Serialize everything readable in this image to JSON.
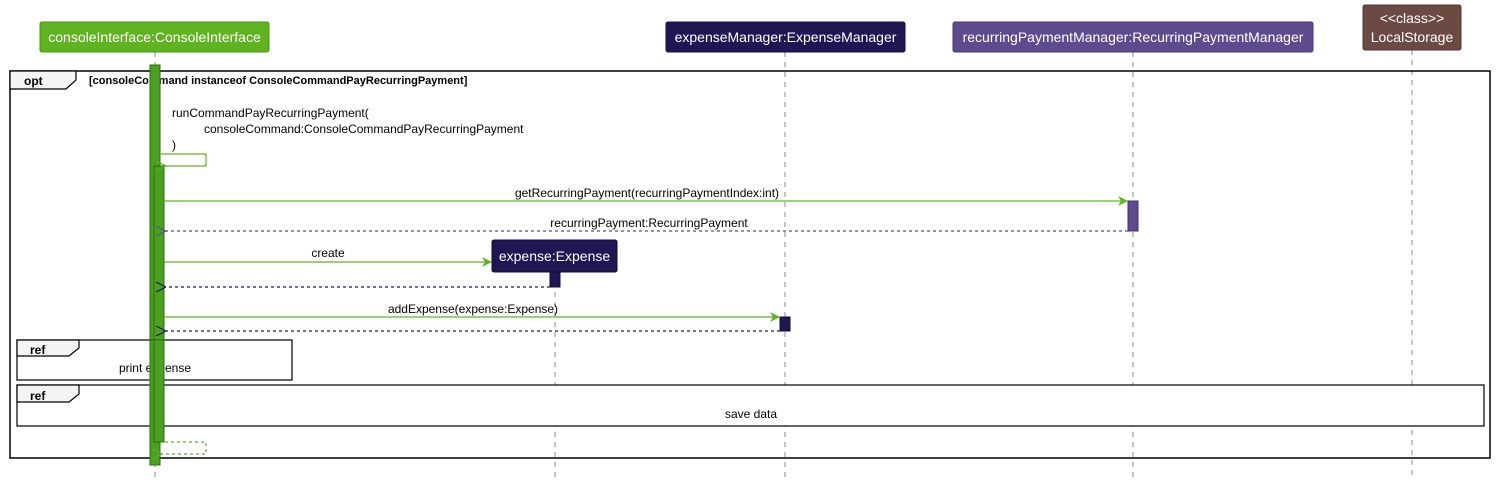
{
  "colors": {
    "console": "#5fb320",
    "console_activation": "#4aa121",
    "expense_manager": "#1f1754",
    "recurring_manager": "#5e4a8c",
    "local_storage": "#6b4a44",
    "expense": "#1f1754",
    "message_line": "#5fb320"
  },
  "participants": {
    "console": "consoleInterface:ConsoleInterface",
    "expense_manager": "expenseManager:ExpenseManager",
    "recurring_manager": "recurringPaymentManager:RecurringPaymentManager",
    "local_storage_stereotype": "<<class>>",
    "local_storage": "LocalStorage",
    "expense": "expense:Expense"
  },
  "opt_frame": {
    "keyword": "opt",
    "guard": "[consoleCommand instanceof ConsoleCommandPayRecurringPayment]"
  },
  "messages": {
    "self_call_line1": "runCommandPayRecurringPayment(",
    "self_call_line2": "consoleCommand:ConsoleCommandPayRecurringPayment",
    "self_call_line3": ")",
    "get_recurring": "getRecurringPayment(recurringPaymentIndex:int)",
    "return_recurring": "recurringPayment:RecurringPayment",
    "create": "create",
    "add_expense": "addExpense(expense:Expense)"
  },
  "refs": [
    {
      "keyword": "ref",
      "text": "print expense"
    },
    {
      "keyword": "ref",
      "text": "save data"
    }
  ]
}
